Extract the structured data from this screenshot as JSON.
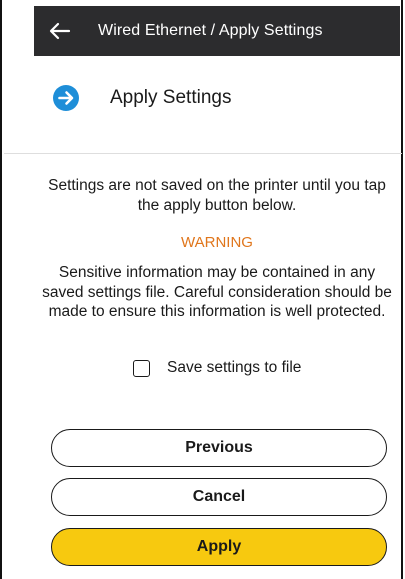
{
  "header": {
    "title": "Wired Ethernet / Apply Settings",
    "back_icon": "back-arrow-icon"
  },
  "section": {
    "icon": "arrow-circle-right-icon",
    "title": "Apply Settings"
  },
  "info_text": "Settings are not saved on the printer until you tap the apply button below.",
  "warning": {
    "title": "WARNING",
    "text": "Sensitive information may be contained in any saved settings file. Careful consideration should be made to ensure this information is well protected."
  },
  "save_option": {
    "label": "Save settings to file",
    "checked": false
  },
  "buttons": {
    "previous": "Previous",
    "cancel": "Cancel",
    "apply": "Apply"
  },
  "colors": {
    "header_bg": "#2c2c2e",
    "accent_blue": "#1e8ed8",
    "warning": "#e0761c",
    "apply_button": "#f7c90f"
  }
}
